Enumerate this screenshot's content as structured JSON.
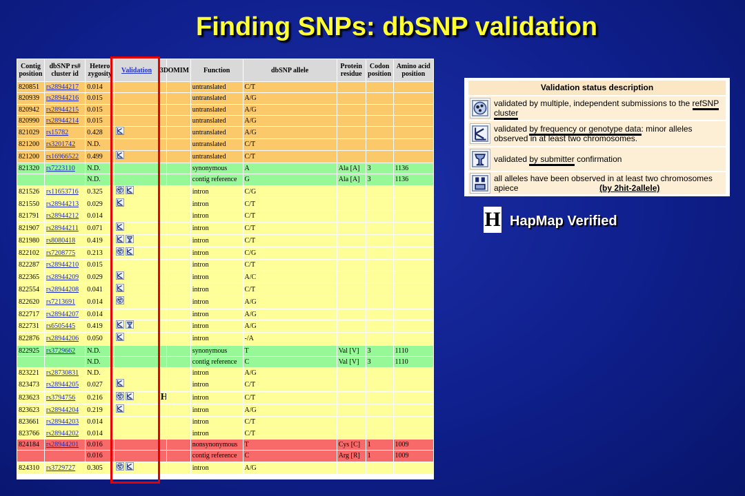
{
  "title": "Finding SNPs:  dbSNP validation",
  "table": {
    "headers": [
      "Contig position",
      "dbSNP rs# cluster id",
      "Hetero zygosity",
      "Validation",
      "3D",
      "OMIM",
      "Function",
      "dbSNP allele",
      "Protein residue",
      "Codon position",
      "Amino acid position"
    ],
    "rows": [
      {
        "color": "orange",
        "pos": "820851",
        "rs": "rs28944217",
        "het": "0.014",
        "val": [],
        "hap": "",
        "func": "untranslated",
        "allele": "C/T",
        "prot": "",
        "codon": "",
        "aa": ""
      },
      {
        "color": "orange",
        "pos": "820939",
        "rs": "rs28944216",
        "het": "0.015",
        "val": [],
        "hap": "",
        "func": "untranslated",
        "allele": "A/G",
        "prot": "",
        "codon": "",
        "aa": ""
      },
      {
        "color": "orange",
        "pos": "820942",
        "rs": "rs28944215",
        "het": "0.015",
        "val": [],
        "hap": "",
        "func": "untranslated",
        "allele": "A/G",
        "prot": "",
        "codon": "",
        "aa": ""
      },
      {
        "color": "orange",
        "pos": "820990",
        "rs": "rs28944214",
        "het": "0.015",
        "val": [],
        "hap": "",
        "func": "untranslated",
        "allele": "A/G",
        "prot": "",
        "codon": "",
        "aa": ""
      },
      {
        "color": "orange",
        "pos": "821029",
        "rs": "rs15782",
        "het": "0.428",
        "val": [
          "freq"
        ],
        "hap": "",
        "func": "untranslated",
        "allele": "A/G",
        "prot": "",
        "codon": "",
        "aa": ""
      },
      {
        "color": "orange",
        "pos": "821200",
        "rs": "rs3201742",
        "het": "N.D.",
        "val": [],
        "hap": "",
        "func": "untranslated",
        "allele": "C/T",
        "prot": "",
        "codon": "",
        "aa": ""
      },
      {
        "color": "orange",
        "pos": "821200",
        "rs": "rs16966522",
        "het": "0.499",
        "val": [
          "freq"
        ],
        "hap": "",
        "func": "untranslated",
        "allele": "C/T",
        "prot": "",
        "codon": "",
        "aa": ""
      },
      {
        "color": "green",
        "pos": "821320",
        "rs": "rs7223110",
        "het": "N.D.",
        "val": [],
        "hap": "",
        "func": "synonymous",
        "allele": "A",
        "prot": "Ala [A]",
        "codon": "3",
        "aa": "1136"
      },
      {
        "color": "green",
        "pos": "",
        "rs": "",
        "het": "N.D.",
        "val": [],
        "hap": "",
        "func": "contig reference",
        "allele": "G",
        "prot": "Ala [A]",
        "codon": "3",
        "aa": "1136"
      },
      {
        "color": "yellow",
        "pos": "821526",
        "rs": "rs11653716",
        "het": "0.325",
        "val": [
          "cluster",
          "freq"
        ],
        "hap": "",
        "func": "intron",
        "allele": "C/G",
        "prot": "",
        "codon": "",
        "aa": ""
      },
      {
        "color": "yellow",
        "pos": "821550",
        "rs": "rs28944213",
        "het": "0.029",
        "val": [
          "freq"
        ],
        "hap": "",
        "func": "intron",
        "allele": "C/T",
        "prot": "",
        "codon": "",
        "aa": ""
      },
      {
        "color": "yellow",
        "pos": "821791",
        "rs": "rs28944212",
        "het": "0.014",
        "val": [],
        "hap": "",
        "func": "intron",
        "allele": "C/T",
        "prot": "",
        "codon": "",
        "aa": ""
      },
      {
        "color": "yellow",
        "pos": "821907",
        "rs": "rs28944211",
        "het": "0.071",
        "val": [
          "freq"
        ],
        "hap": "",
        "func": "intron",
        "allele": "C/T",
        "prot": "",
        "codon": "",
        "aa": ""
      },
      {
        "color": "yellow",
        "pos": "821980",
        "rs": "rs8080418",
        "het": "0.419",
        "val": [
          "freq",
          "submitter"
        ],
        "hap": "",
        "func": "intron",
        "allele": "C/T",
        "prot": "",
        "codon": "",
        "aa": ""
      },
      {
        "color": "yellow",
        "pos": "822102",
        "rs": "rs7208775",
        "het": "0.213",
        "val": [
          "cluster",
          "freq"
        ],
        "hap": "",
        "func": "intron",
        "allele": "C/G",
        "prot": "",
        "codon": "",
        "aa": ""
      },
      {
        "color": "yellow",
        "pos": "822287",
        "rs": "rs28944210",
        "het": "0.015",
        "val": [],
        "hap": "",
        "func": "intron",
        "allele": "C/T",
        "prot": "",
        "codon": "",
        "aa": ""
      },
      {
        "color": "yellow",
        "pos": "822365",
        "rs": "rs28944209",
        "het": "0.029",
        "val": [
          "freq"
        ],
        "hap": "",
        "func": "intron",
        "allele": "A/C",
        "prot": "",
        "codon": "",
        "aa": ""
      },
      {
        "color": "yellow",
        "pos": "822554",
        "rs": "rs28944208",
        "het": "0.041",
        "val": [
          "freq"
        ],
        "hap": "",
        "func": "intron",
        "allele": "C/T",
        "prot": "",
        "codon": "",
        "aa": ""
      },
      {
        "color": "yellow",
        "pos": "822620",
        "rs": "rs7213691",
        "het": "0.014",
        "val": [
          "cluster"
        ],
        "hap": "",
        "func": "intron",
        "allele": "A/G",
        "prot": "",
        "codon": "",
        "aa": ""
      },
      {
        "color": "yellow",
        "pos": "822717",
        "rs": "rs28944207",
        "het": "0.014",
        "val": [],
        "hap": "",
        "func": "intron",
        "allele": "A/G",
        "prot": "",
        "codon": "",
        "aa": ""
      },
      {
        "color": "yellow",
        "pos": "822731",
        "rs": "rs6505445",
        "het": "0.419",
        "val": [
          "freq",
          "submitter"
        ],
        "hap": "",
        "func": "intron",
        "allele": "A/G",
        "prot": "",
        "codon": "",
        "aa": ""
      },
      {
        "color": "yellow",
        "pos": "822876",
        "rs": "rs28944206",
        "het": "0.050",
        "val": [
          "freq"
        ],
        "hap": "",
        "func": "intron",
        "allele": "-/A",
        "prot": "",
        "codon": "",
        "aa": ""
      },
      {
        "color": "green",
        "pos": "822925",
        "rs": "rs3729662",
        "het": "N.D.",
        "val": [],
        "hap": "",
        "func": "synonymous",
        "allele": "T",
        "prot": "Val [V]",
        "codon": "3",
        "aa": "1110"
      },
      {
        "color": "green",
        "pos": "",
        "rs": "",
        "het": "N.D.",
        "val": [],
        "hap": "",
        "func": "contig reference",
        "allele": "C",
        "prot": "Val [V]",
        "codon": "3",
        "aa": "1110"
      },
      {
        "color": "yellow",
        "pos": "823221",
        "rs": "rs28730831",
        "het": "N.D.",
        "val": [],
        "hap": "",
        "func": "intron",
        "allele": "A/G",
        "prot": "",
        "codon": "",
        "aa": ""
      },
      {
        "color": "yellow",
        "pos": "823473",
        "rs": "rs28944205",
        "het": "0.027",
        "val": [
          "freq"
        ],
        "hap": "",
        "func": "intron",
        "allele": "C/T",
        "prot": "",
        "codon": "",
        "aa": ""
      },
      {
        "color": "yellow",
        "pos": "823623",
        "rs": "rs3794756",
        "het": "0.216",
        "val": [
          "cluster",
          "freq"
        ],
        "hap": "H",
        "func": "intron",
        "allele": "C/T",
        "prot": "",
        "codon": "",
        "aa": ""
      },
      {
        "color": "yellow",
        "pos": "823623",
        "rs": "rs28944204",
        "het": "0.219",
        "val": [
          "freq"
        ],
        "hap": "",
        "func": "intron",
        "allele": "A/G",
        "prot": "",
        "codon": "",
        "aa": ""
      },
      {
        "color": "yellow",
        "pos": "823661",
        "rs": "rs28944203",
        "het": "0.014",
        "val": [],
        "hap": "",
        "func": "intron",
        "allele": "C/T",
        "prot": "",
        "codon": "",
        "aa": ""
      },
      {
        "color": "yellow",
        "pos": "823766",
        "rs": "rs28944202",
        "het": "0.014",
        "val": [],
        "hap": "",
        "func": "intron",
        "allele": "C/T",
        "prot": "",
        "codon": "",
        "aa": ""
      },
      {
        "color": "red",
        "pos": "824184",
        "rs": "rs28944201",
        "het": "0.016",
        "val": [],
        "hap": "",
        "func": "nonsynonymous",
        "allele": "T",
        "prot": "Cys [C]",
        "codon": "1",
        "aa": "1009"
      },
      {
        "color": "red",
        "pos": "",
        "rs": "",
        "het": "0.016",
        "val": [],
        "hap": "",
        "func": "contig reference",
        "allele": "C",
        "prot": "Arg [R]",
        "codon": "1",
        "aa": "1009"
      },
      {
        "color": "yellow",
        "pos": "824310",
        "rs": "rs3729727",
        "het": "0.305",
        "val": [
          "cluster",
          "freq"
        ],
        "hap": "",
        "func": "intron",
        "allele": "A/G",
        "prot": "",
        "codon": "",
        "aa": ""
      }
    ]
  },
  "legend": {
    "title": "Validation status description",
    "rows": [
      {
        "icon": "cluster-icon",
        "pre": "validated by multiple, independent submissions to the ",
        "ul": "refSNP cluster",
        "post": ""
      },
      {
        "icon": "frequency-icon",
        "pre": "validated ",
        "ul": "by frequency or genotype data",
        "post": ": minor alleles observed in at least two chromosomes."
      },
      {
        "icon": "submitter-icon",
        "pre": "validated ",
        "ul": "by submitter",
        "post": " confirmation"
      },
      {
        "icon": "2hit-2allele-icon",
        "pre": "all alleles have been observed in at least two chromosomes apiece",
        "ul": "",
        "post": ""
      }
    ],
    "note": "(by 2hit-2allele)"
  },
  "hapmap": {
    "icon_letter": "H",
    "label": "HapMap Verified"
  },
  "colors": {
    "title": "#ffff33",
    "row_orange": "#fbc96a",
    "row_green": "#96f896",
    "row_yellow": "#ffff99",
    "row_red": "#f86a6a",
    "highlight_box": "#e80000"
  }
}
